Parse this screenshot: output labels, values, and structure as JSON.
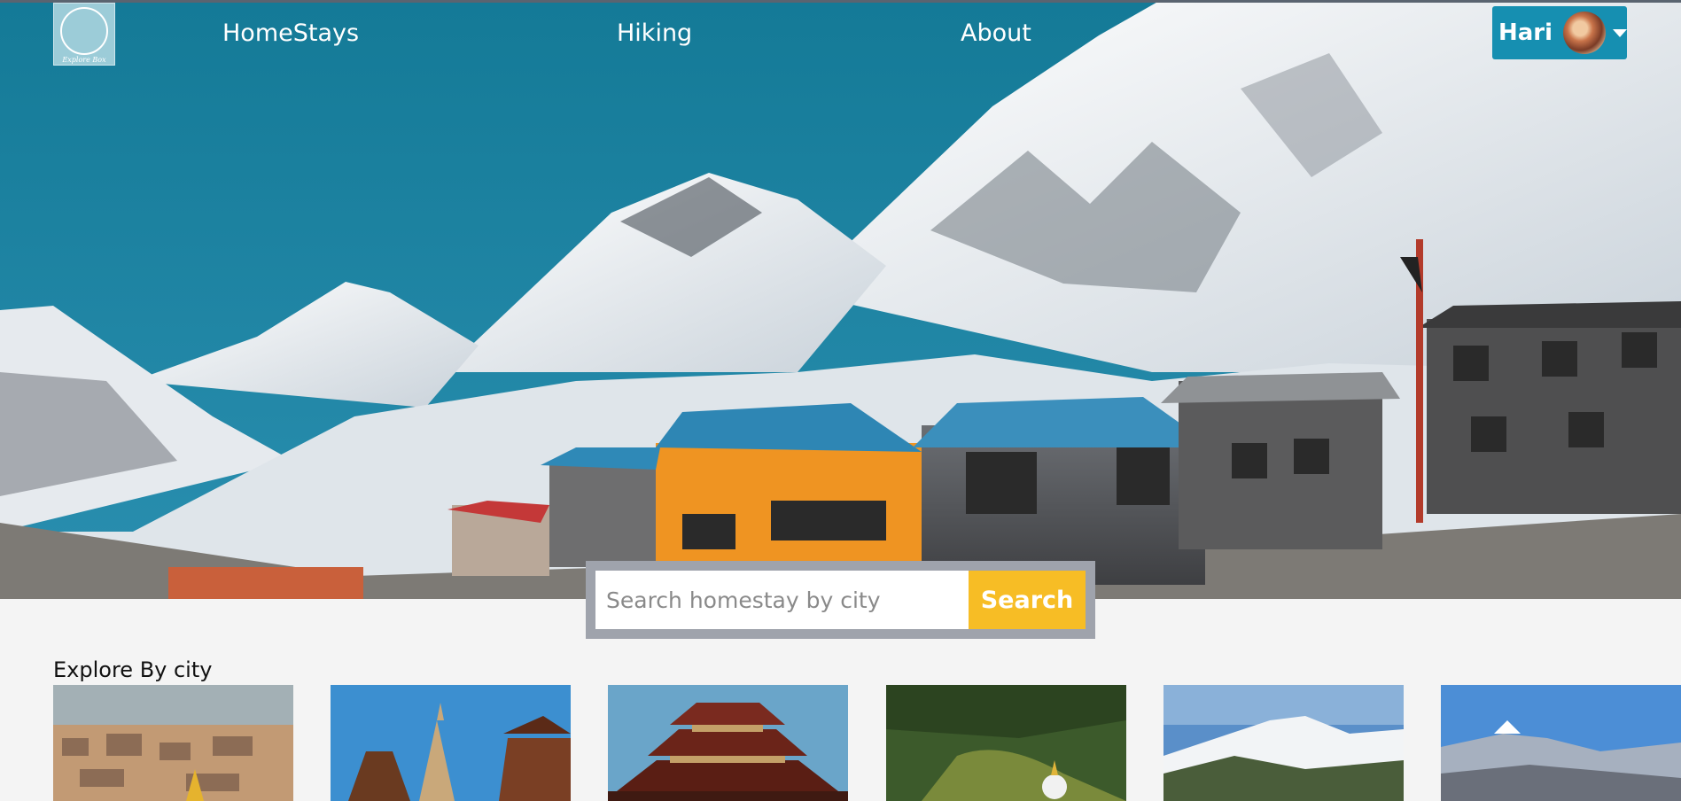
{
  "nav": {
    "logo_text": "Explore Box",
    "links": [
      "HomeStays",
      "Hiking",
      "About"
    ],
    "user": {
      "name": "Hari"
    }
  },
  "search": {
    "placeholder": "Search homestay by city",
    "button_label": "Search"
  },
  "explore": {
    "title": "Explore By city"
  },
  "colors": {
    "sky": "#1b7d99",
    "search_button": "#f7bd25",
    "user_pill": "#168fb1"
  }
}
